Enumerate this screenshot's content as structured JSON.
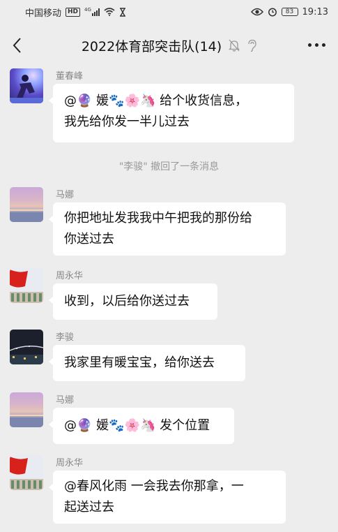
{
  "status_bar": {
    "carrier": "中国移动",
    "hd": "HD",
    "net": "4G",
    "battery": "83",
    "time": "19:13"
  },
  "header": {
    "title": "2022体育部突击队(14)"
  },
  "system_notice": "\"李骏\" 撤回了一条消息",
  "messages": [
    {
      "sender": "董春峰",
      "line1": "@🔮 媛🐾🌸🦄 给个收货信息，",
      "line2": "我先给你发一半儿过去"
    },
    {
      "sender": "马娜",
      "line1": "你把地址发我我中午把我的那份给",
      "line2": "你送过去"
    },
    {
      "sender": "周永华",
      "line1": "收到，以后给你送过去"
    },
    {
      "sender": "李骏",
      "line1": "我家里有暖宝宝，给你送去"
    },
    {
      "sender": "马娜",
      "line1": "@🔮 媛🐾🌸🦄 发个位置"
    },
    {
      "sender": "周永华",
      "line1": "@春风化雨  一会我去你那拿，一",
      "line2": "起送过去"
    }
  ]
}
